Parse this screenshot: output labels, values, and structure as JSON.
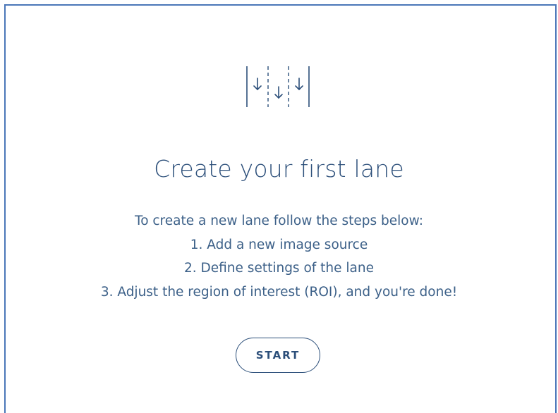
{
  "empty_state": {
    "icon": "lanes-down-arrows-icon",
    "title": "Create your first lane",
    "instructions": {
      "intro": "To create a new lane follow the steps below:",
      "steps": [
        "1. Add a new image source",
        "2. Define settings of the lane",
        "3. Adjust the region of interest (ROI), and you're done!"
      ]
    },
    "start_label": "START"
  },
  "colors": {
    "border": "#4a76b8",
    "title": "#2c4f7a",
    "text": "#3c6088"
  }
}
